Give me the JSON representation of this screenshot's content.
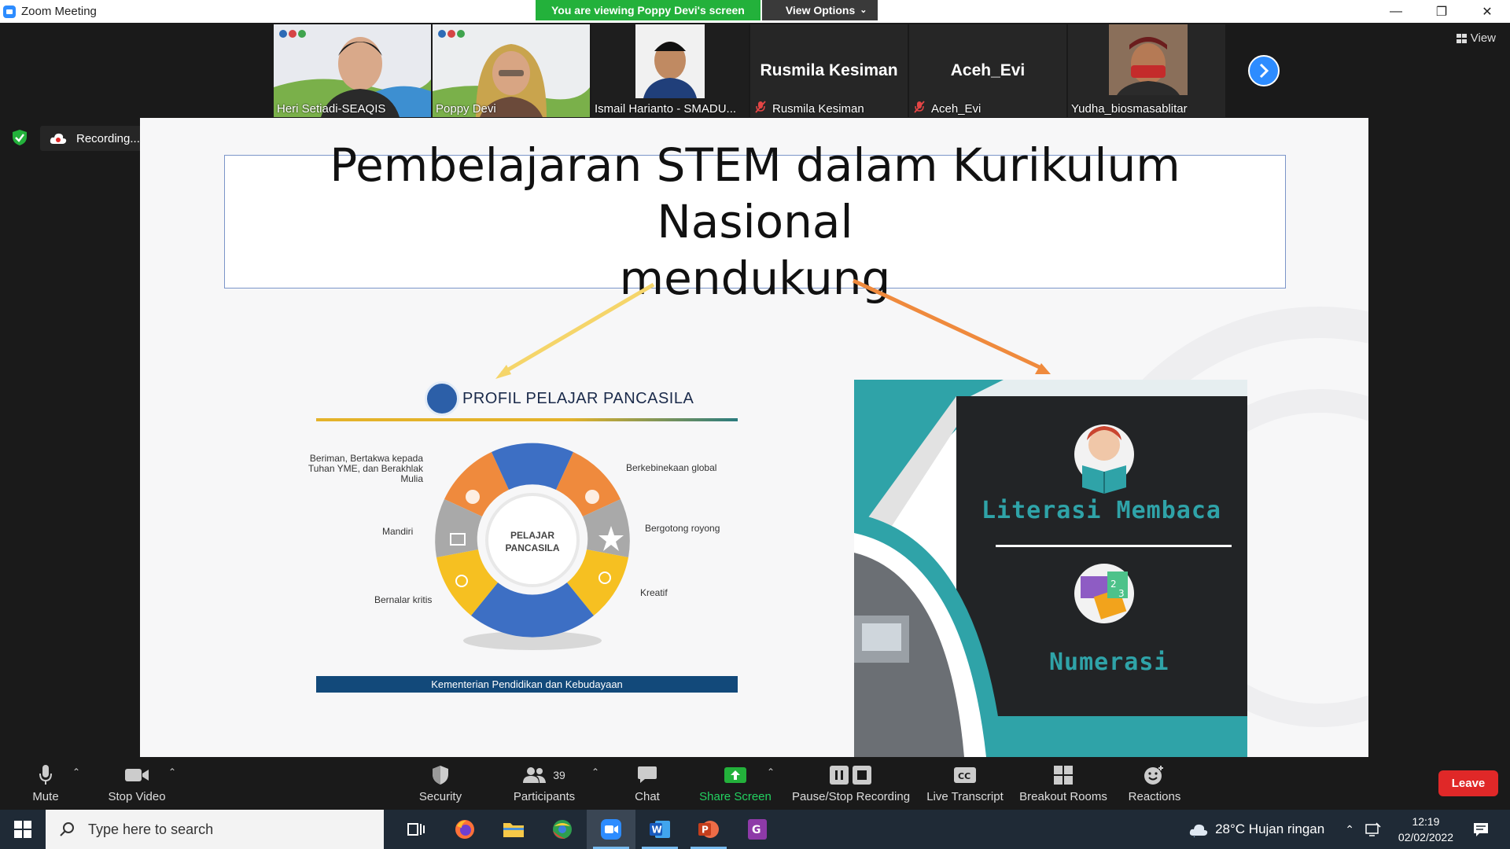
{
  "window": {
    "title": "Zoom Meeting"
  },
  "banner": {
    "viewing_text": "You are viewing Poppy Devi's screen",
    "view_options_label": "View Options"
  },
  "view_button_label": "View",
  "participants_strip": [
    {
      "name": "Heri Setiadi-SEAQIS",
      "video": true,
      "muted": false,
      "active": false
    },
    {
      "name": "Poppy Devi",
      "video": true,
      "muted": false,
      "active": false
    },
    {
      "name": "Ismail Harianto - SMADU...",
      "video": true,
      "muted": false,
      "active": true
    },
    {
      "name": "Rusmila Kesiman",
      "display_name": "Rusmila Kesiman",
      "video": false,
      "muted": true,
      "active": false
    },
    {
      "name": "Aceh_Evi",
      "display_name": "Aceh_Evi",
      "video": false,
      "muted": true,
      "active": false
    },
    {
      "name": "Yudha_biosmasablitar",
      "video": true,
      "muted": false,
      "active": false
    }
  ],
  "recording": {
    "status_text": "Recording..."
  },
  "slide": {
    "title_line1": "Pembelajaran STEM dalam Kurikulum Nasional",
    "title_line2": "mendukung",
    "profile": {
      "heading": "PROFIL PELAJAR PANCASILA",
      "center_line1": "PELAJAR",
      "center_line2": "PANCASILA",
      "labels": {
        "beriman_1": "Beriman, Bertakwa kepada",
        "beriman_2": "Tuhan YME, dan Berakhlak",
        "beriman_3": "Mulia",
        "berkebinekaan": "Berkebinekaan global",
        "mandiri": "Mandiri",
        "gotong_royong": "Bergotong royong",
        "bernalar": "Bernalar kritis",
        "kreatif": "Kreatif"
      },
      "footer": "Kementerian Pendidikan dan Kebudayaan"
    },
    "literacy_title": "Literasi Membaca",
    "numeracy_title": "Numerasi",
    "colors": {
      "yellow_arrow": "#f5d56a",
      "orange_arrow": "#ef8a3d",
      "teal": "#2fa3a8",
      "dark_panel": "#222426"
    }
  },
  "toolbar": {
    "mute": "Mute",
    "stop_video": "Stop Video",
    "security": "Security",
    "participants": "Participants",
    "participants_count": "39",
    "chat": "Chat",
    "share_screen": "Share Screen",
    "pause_stop_recording": "Pause/Stop Recording",
    "live_transcript": "Live Transcript",
    "breakout_rooms": "Breakout Rooms",
    "reactions": "Reactions",
    "leave": "Leave"
  },
  "taskbar": {
    "search_placeholder": "Type here to search",
    "weather": "28°C  Hujan ringan",
    "time": "12:19",
    "date": "02/02/2022"
  }
}
